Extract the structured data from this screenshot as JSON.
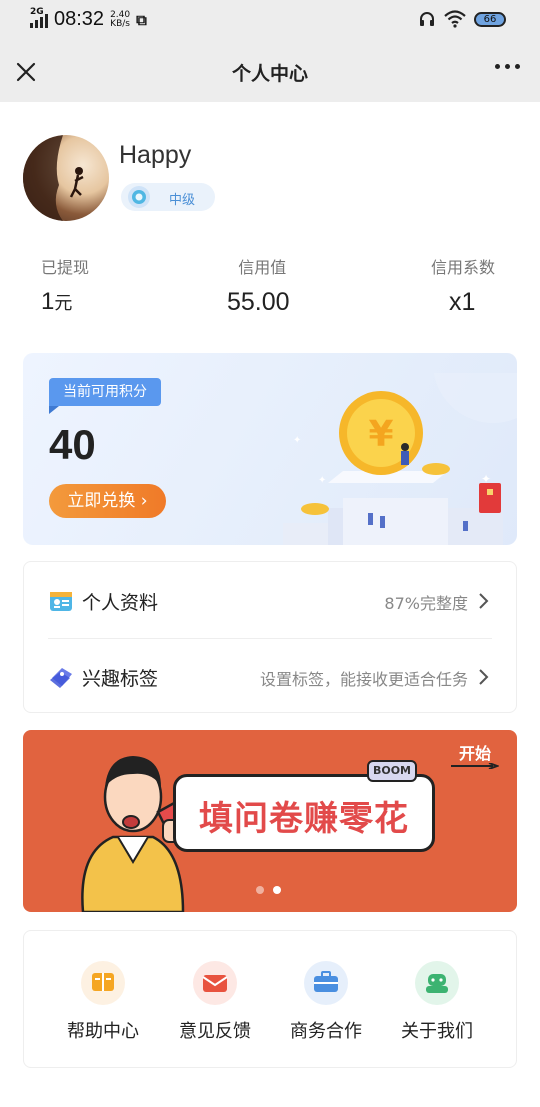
{
  "status_bar": {
    "network": "2G",
    "time": "08:32",
    "speed_value": "2.40",
    "speed_unit": "KB/s",
    "battery": "66"
  },
  "nav": {
    "title": "个人中心"
  },
  "profile": {
    "username": "Happy",
    "level": "中级"
  },
  "stats": [
    {
      "label": "已提现",
      "value": "1",
      "unit": "元"
    },
    {
      "label": "信用值",
      "value": "55.00",
      "unit": ""
    },
    {
      "label": "信用系数",
      "value": "x1",
      "unit": ""
    }
  ],
  "points": {
    "tag": "当前可用积分",
    "value": "40",
    "button": "立即兑换",
    "button_chevron": "›"
  },
  "menu": [
    {
      "icon": "id-card-icon",
      "label": "个人资料",
      "value": "87%完整度"
    },
    {
      "icon": "tag-icon",
      "label": "兴趣标签",
      "value": "设置标签，能接收更适合任务"
    }
  ],
  "banner": {
    "title": "填问卷赚零花",
    "boom": "BOOM",
    "start": "开始",
    "slides": 2,
    "active_slide": 2
  },
  "grid": [
    {
      "icon": "book-icon",
      "label": "帮助中心",
      "color": "#f5a623",
      "bg": "#fdf1e2"
    },
    {
      "icon": "mail-icon",
      "label": "意见反馈",
      "color": "#e8533f",
      "bg": "#fde8e4"
    },
    {
      "icon": "briefcase-icon",
      "label": "商务合作",
      "color": "#4a8fe0",
      "bg": "#e6effb"
    },
    {
      "icon": "robot-icon",
      "label": "关于我们",
      "color": "#3cb371",
      "bg": "#e2f5ea"
    }
  ],
  "colors": {
    "accent_blue": "#5a98ee",
    "orange": "#f07a28",
    "banner_red": "#e1633f"
  }
}
